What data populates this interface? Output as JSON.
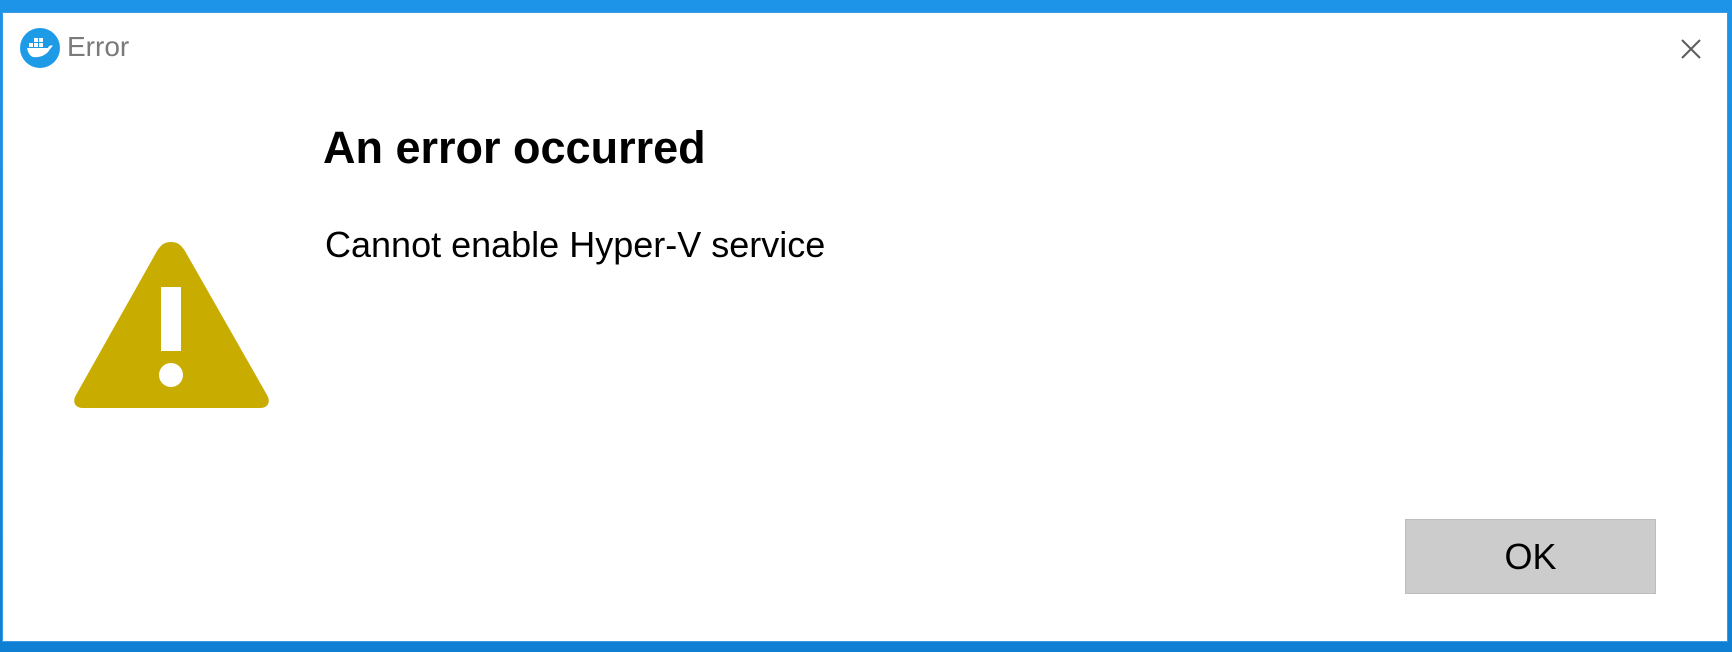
{
  "window": {
    "title": "Error",
    "app_icon": "docker-whale-icon",
    "close_icon": "close-icon"
  },
  "content": {
    "heading": "An error occurred",
    "message": "Cannot enable Hyper-V service",
    "icon": "warning-icon"
  },
  "buttons": {
    "ok_label": "OK"
  },
  "colors": {
    "accent": "#1d9be6",
    "warning": "#c9ac00",
    "button_bg": "#cccccc",
    "desktop": "#1a8fe0"
  }
}
